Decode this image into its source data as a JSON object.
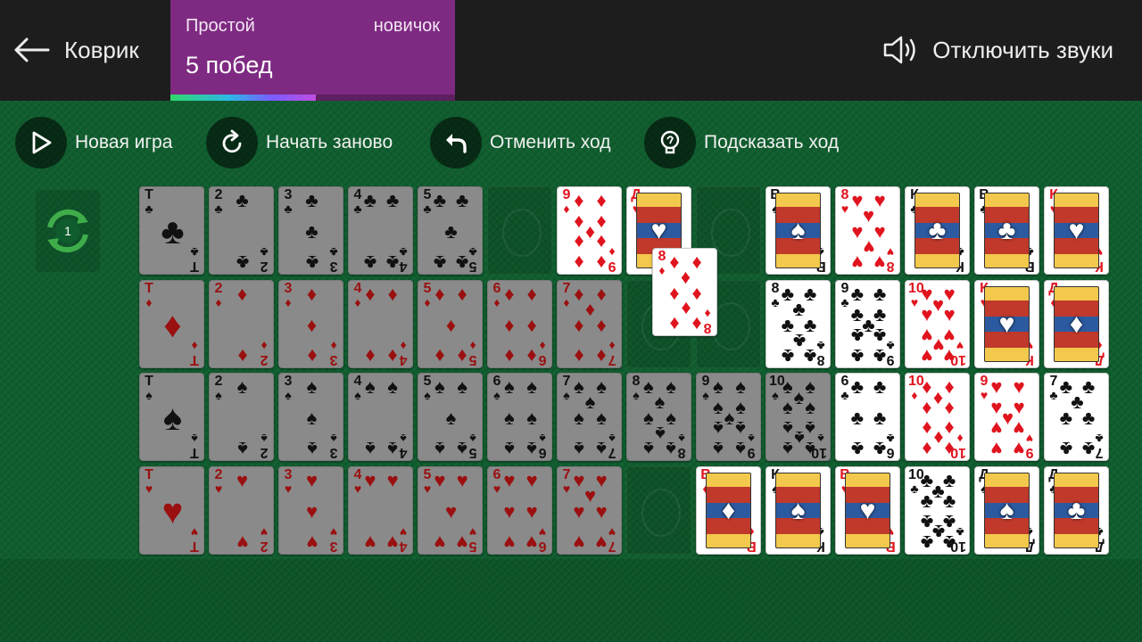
{
  "header": {
    "back_label": "Коврик",
    "difficulty": "Простой",
    "rank": "новичок",
    "wins": "5 побед",
    "progress": 0.51,
    "sound_label": "Отключить звуки"
  },
  "toolbar": {
    "new_game": "Новая игра",
    "restart": "Начать заново",
    "undo": "Отменить ход",
    "hint": "Подсказать ход"
  },
  "deal": {
    "count": "1"
  },
  "colors": {
    "red": "#e0141e",
    "black": "#111111",
    "felt": "#0f5d2e",
    "stats_bg": "#7e2a82"
  },
  "rows": [
    [
      "Т♣*",
      "2♣*",
      "3♣*",
      "4♣*",
      "5♣*",
      "",
      "9♦",
      "Д♥",
      "",
      "В♠",
      "8♥",
      "К♣",
      "В♣",
      "К♥"
    ],
    [
      "Т♦*",
      "2♦*",
      "3♦*",
      "4♦*",
      "5♦*",
      "6♦*",
      "7♦*",
      "",
      "",
      "8♣",
      "9♣",
      "10♥",
      "К♥",
      "Д♦"
    ],
    [
      "Т♠*",
      "2♠*",
      "3♠*",
      "4♠*",
      "5♠*",
      "6♠*",
      "7♠*",
      "8♠*",
      "9♠*",
      "10♠*",
      "6♣",
      "10♦",
      "9♥",
      "7♣"
    ],
    [
      "Т♥*",
      "2♥*",
      "3♥*",
      "4♥*",
      "5♥*",
      "6♥*",
      "7♥*",
      "",
      "В♦",
      "К♠",
      "В♥",
      "10♣",
      "Д♠",
      "Д♣"
    ]
  ],
  "dragging": "8♦"
}
